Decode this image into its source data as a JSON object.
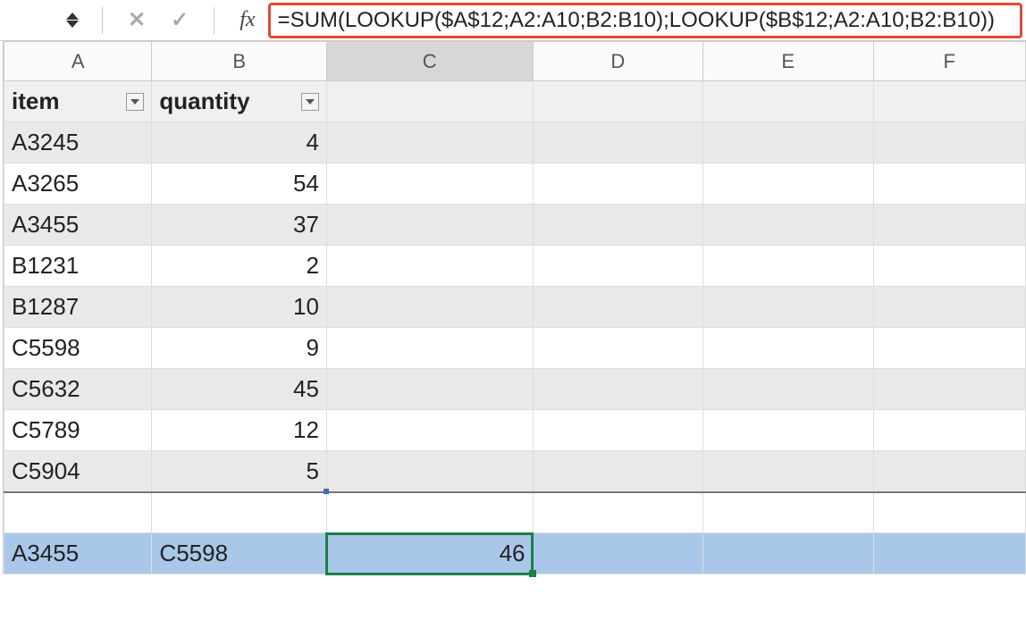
{
  "formula_bar": {
    "formula": "=SUM(LOOKUP($A$12;A2:A10;B2:B10);LOOKUP($B$12;A2:A10;B2:B10))",
    "fx_label": "fx"
  },
  "columns": [
    "A",
    "B",
    "C",
    "D",
    "E",
    "F"
  ],
  "headers": {
    "colA": "item",
    "colB": "quantity"
  },
  "rows": [
    {
      "item": "A3245",
      "qty": "4",
      "stripe": true
    },
    {
      "item": "A3265",
      "qty": "54",
      "stripe": false
    },
    {
      "item": "A3455",
      "qty": "37",
      "stripe": true
    },
    {
      "item": "B1231",
      "qty": "2",
      "stripe": false
    },
    {
      "item": "B1287",
      "qty": "10",
      "stripe": true
    },
    {
      "item": "C5598",
      "qty": "9",
      "stripe": false
    },
    {
      "item": "C5632",
      "qty": "45",
      "stripe": true
    },
    {
      "item": "C5789",
      "qty": "12",
      "stripe": false
    },
    {
      "item": "C5904",
      "qty": "5",
      "stripe": true
    }
  ],
  "lookup_row": {
    "a": "A3455",
    "b": "C5598",
    "result": "46"
  }
}
